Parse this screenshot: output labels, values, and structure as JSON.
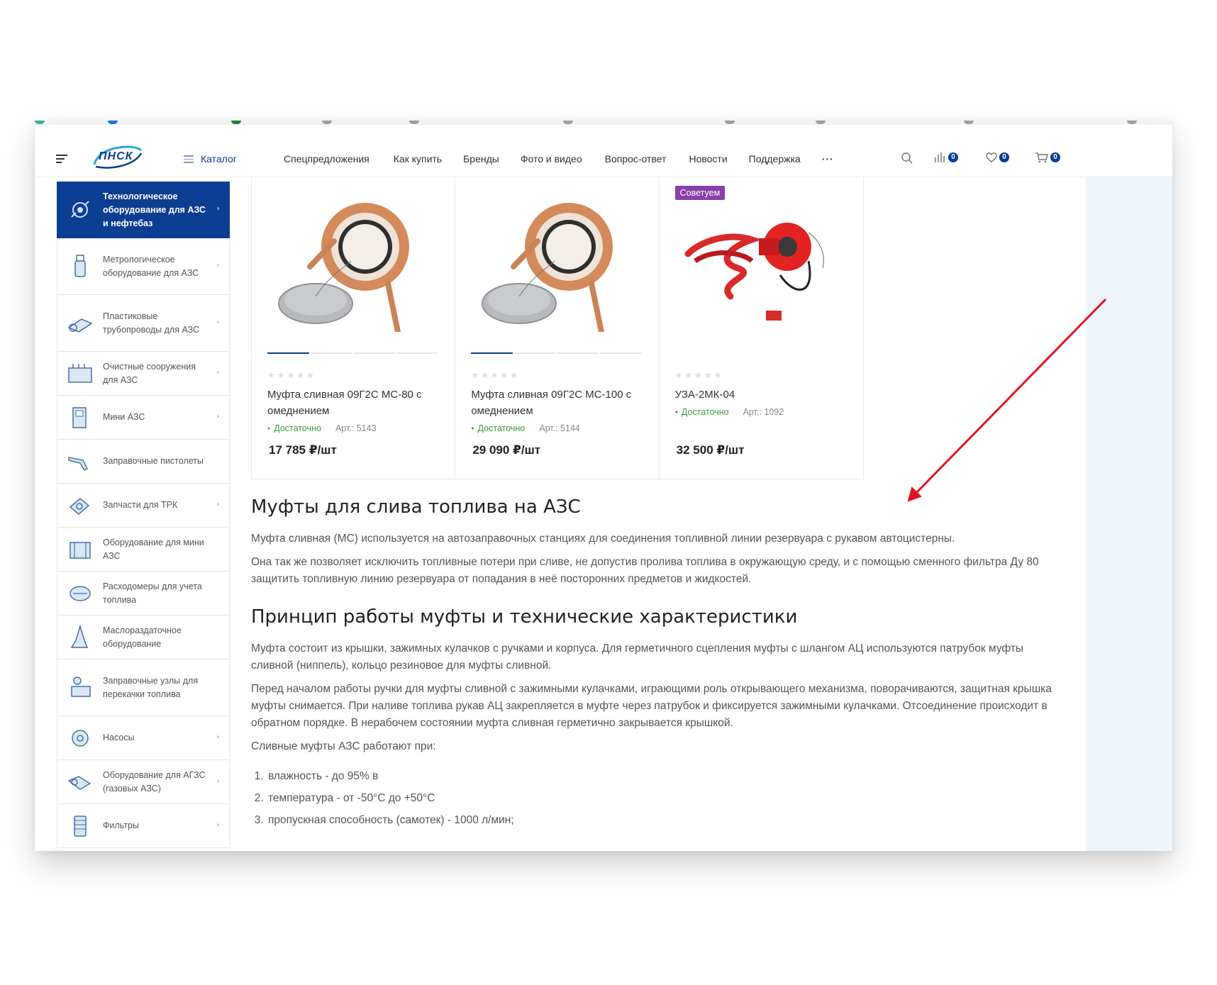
{
  "header": {
    "logo_text": "ПНСК",
    "catalog_label": "Каталог",
    "nav": [
      "Спецпредложения",
      "Как купить",
      "Бренды",
      "Фото и видео",
      "Вопрос-ответ",
      "Новости",
      "Поддержка",
      "···"
    ],
    "compare_count": "0",
    "favorites_count": "0",
    "cart_count": "0",
    "icons": [
      "menu-icon",
      "list-icon",
      "search-icon",
      "compare-icon",
      "heart-icon",
      "cart-icon"
    ]
  },
  "sidebar": {
    "items": [
      {
        "label": "Технологическое оборудование для АЗС и нефтебаз",
        "icon": "gear-equipment-icon",
        "arrow": "›",
        "active": true
      },
      {
        "label": "Метрологическое оборудование для АЗС",
        "icon": "meter-icon",
        "arrow": "›"
      },
      {
        "label": "Пластиковые трубопроводы для АЗС",
        "icon": "pipe-icon",
        "arrow": "›"
      },
      {
        "label": "Очистные сооружения для АЗС",
        "icon": "treatment-icon",
        "arrow": "›"
      },
      {
        "label": "Мини АЗС",
        "icon": "mini-station-icon",
        "arrow": "›"
      },
      {
        "label": "Заправочные пистолеты",
        "icon": "nozzle-icon",
        "arrow": ""
      },
      {
        "label": "Запчасти для ТРК",
        "icon": "parts-icon",
        "arrow": "›"
      },
      {
        "label": "Оборудование для мини АЗС",
        "icon": "mini-equipment-icon",
        "arrow": ""
      },
      {
        "label": "Расходомеры для учета топлива",
        "icon": "flowmeter-icon",
        "arrow": ""
      },
      {
        "label": "Маслораздаточное оборудование",
        "icon": "oil-dispenser-icon",
        "arrow": ""
      },
      {
        "label": "Заправочные узлы для перекачки топлива",
        "icon": "pump-unit-icon",
        "arrow": ""
      },
      {
        "label": "Насосы",
        "icon": "pump-icon",
        "arrow": "›"
      },
      {
        "label": "Оборудование для АГЗС (газовых АЗС)",
        "icon": "gas-equipment-icon",
        "arrow": "›"
      },
      {
        "label": "Фильтры",
        "icon": "filter-icon",
        "arrow": "›"
      }
    ]
  },
  "products": [
    {
      "name": "Муфта сливная 09Г2С МС-80 с омеднением",
      "stock": "Достаточно",
      "article": "Арт.: 5143",
      "price": "17 785 ₽/шт",
      "tag": ""
    },
    {
      "name": "Муфта сливная 09Г2С МС-100 с омеднением",
      "stock": "Достаточно",
      "article": "Арт.: 5144",
      "price": "29 090 ₽/шт",
      "tag": ""
    },
    {
      "name": "УЗА-2МК-04",
      "stock": "Достаточно",
      "article": "Арт.: 1092",
      "price": "32 500 ₽/шт",
      "tag": "Советуем"
    }
  ],
  "article": {
    "h1": "Муфты для слива топлива на АЗС",
    "p1": "Муфта сливная (МС) используется на автозаправочных станциях для соединения топливной линии резервуара с рукавом автоцистерны.",
    "p2": "Она так же позволяет исключить топливные потери при сливе, не допустив пролива топлива в окружающую среду, и с помощью сменного фильтра Ду 80 защитить топливную линию резервуара от попадания в неё посторонних предметов и жидкостей.",
    "h2": "Принцип работы муфты и технические характеристики",
    "p3": "Муфта состоит из крышки, зажимных кулачков с ручками и корпуса. Для герметичного сцепления муфты с шлангом АЦ используются патрубок муфты сливной (ниппель), кольцо резиновое для муфты сливной.",
    "p4": "Перед началом работы ручки для муфты сливной с зажимными кулачками, играющими роль открывающего механизма, поворачиваются, защитная крышка муфты снимается. При наливе топлива рукав АЦ закрепляется в муфте через патрубок и фиксируется зажимными кулачками. Отсоединение происходит в обратном порядке. В нерабочем состоянии муфта сливная герметично закрывается крышкой.",
    "p5": "Сливные муфты АЗС работают при:",
    "list": [
      "влажность - до 95% в",
      "температура - от -50°С до +50°С",
      "пропускная способность (самотек) - 1000 л/мин;"
    ]
  },
  "colors": {
    "brand": "#0b3d91",
    "stock": "#3a9a3a",
    "tag": "#8b3fa8",
    "annotation_arrow": "#e0141e"
  }
}
